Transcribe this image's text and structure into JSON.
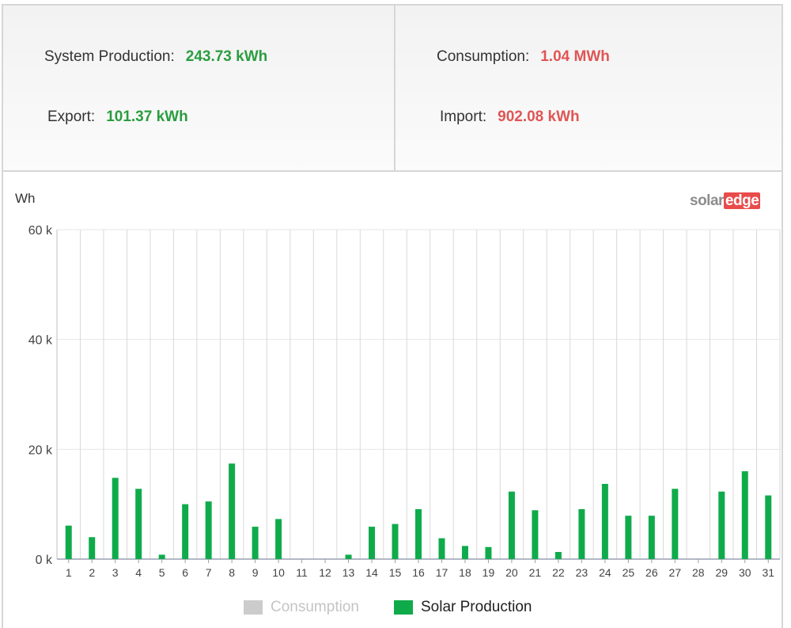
{
  "summary": {
    "production_label": "System Production:",
    "production_value": "243.73 kWh",
    "export_label": "Export:",
    "export_value": "101.37 kWh",
    "consumption_label": "Consumption:",
    "consumption_value": "1.04 MWh",
    "import_label": "Import:",
    "import_value": "902.08 kWh"
  },
  "logo": {
    "part1": "solar",
    "part2": "edge"
  },
  "colors": {
    "production": "#0fab4b",
    "consumption": "#cccccc",
    "positive_value": "#2a9d3f",
    "negative_value": "#e05555"
  },
  "chart_data": {
    "type": "bar",
    "ylabel": "Wh",
    "ylim": [
      0,
      60000
    ],
    "yticks": [
      {
        "value": 0,
        "label": "0 k"
      },
      {
        "value": 20000,
        "label": "20 k"
      },
      {
        "value": 40000,
        "label": "40 k"
      },
      {
        "value": 60000,
        "label": "60 k"
      }
    ],
    "categories": [
      "1",
      "2",
      "3",
      "4",
      "5",
      "6",
      "7",
      "8",
      "9",
      "10",
      "11",
      "12",
      "13",
      "14",
      "15",
      "16",
      "17",
      "18",
      "19",
      "20",
      "21",
      "22",
      "23",
      "24",
      "25",
      "26",
      "27",
      "28",
      "29",
      "30",
      "31"
    ],
    "series": [
      {
        "name": "Consumption",
        "values": [
          0,
          0,
          0,
          0,
          0,
          0,
          0,
          0,
          0,
          0,
          0,
          0,
          0,
          0,
          0,
          0,
          0,
          0,
          0,
          0,
          0,
          0,
          0,
          0,
          0,
          0,
          0,
          0,
          0,
          0,
          0
        ]
      },
      {
        "name": "Solar Production",
        "values": [
          6100,
          4000,
          14800,
          12800,
          800,
          10000,
          10500,
          17400,
          5900,
          7300,
          0,
          0,
          800,
          5900,
          6400,
          9100,
          3800,
          2400,
          2200,
          12300,
          8900,
          1300,
          9100,
          13700,
          7900,
          7900,
          12800,
          0,
          12300,
          16000,
          11600
        ]
      }
    ],
    "grid": true,
    "legend_position": "bottom-center",
    "legend_inactive": [
      "Consumption"
    ]
  }
}
